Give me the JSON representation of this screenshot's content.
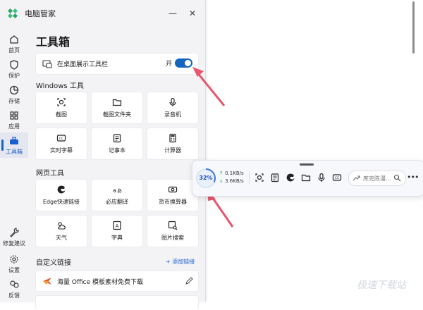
{
  "window": {
    "title": "电脑管家",
    "controls": [
      "—",
      "✕"
    ]
  },
  "sidebar": {
    "items": [
      {
        "label": "首页",
        "icon": "home-icon"
      },
      {
        "label": "保护",
        "icon": "shield-icon"
      },
      {
        "label": "存储",
        "icon": "pie-chart-icon"
      },
      {
        "label": "应用",
        "icon": "apps-icon"
      },
      {
        "label": "工具箱",
        "icon": "toolbox-icon",
        "active": true
      },
      {
        "label": "修复建议",
        "icon": "wrench-icon"
      },
      {
        "label": "设置",
        "icon": "gear-icon"
      },
      {
        "label": "反馈",
        "icon": "feedback-icon"
      }
    ]
  },
  "main": {
    "title": "工具箱",
    "toggle": {
      "label": "在桌面展示工具栏",
      "state_label": "开",
      "on": true
    },
    "windows_section": "Windows 工具",
    "windows_tools": [
      {
        "label": "截图",
        "icon": "screenshot-icon"
      },
      {
        "label": "截图文件夹",
        "icon": "folder-icon"
      },
      {
        "label": "录音机",
        "icon": "microphone-icon"
      },
      {
        "label": "实时字幕",
        "icon": "captions-icon"
      },
      {
        "label": "记事本",
        "icon": "notepad-icon"
      },
      {
        "label": "计算器",
        "icon": "calculator-icon"
      }
    ],
    "web_section": "网页工具",
    "web_tools": [
      {
        "label": "Edge快速链接",
        "icon": "edge-icon"
      },
      {
        "label": "必应翻译",
        "icon": "translate-icon"
      },
      {
        "label": "货币换算器",
        "icon": "currency-icon"
      },
      {
        "label": "天气",
        "icon": "weather-icon"
      },
      {
        "label": "字典",
        "icon": "dictionary-icon"
      },
      {
        "label": "图片搜索",
        "icon": "image-search-icon"
      }
    ],
    "custom_section": "自定义链接",
    "add_link": "+ 添加链接",
    "custom_links": [
      {
        "label": "海量 Office 模板素材免费下载",
        "icon": "office-template-icon"
      }
    ]
  },
  "toolbar": {
    "gauge_value": "32%",
    "gauge_fraction": 0.32,
    "upload": "0.1KB/s",
    "download": "3.6KB/s",
    "search_placeholder": "库克陈漫...",
    "more": "•••"
  },
  "watermark": "极速下载站",
  "colors": {
    "accent": "#1565c0",
    "arrow": "#e8556d",
    "gauge": "#3a78e0"
  }
}
